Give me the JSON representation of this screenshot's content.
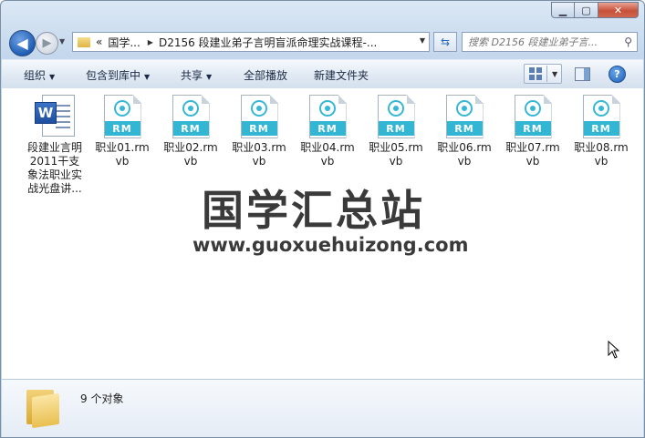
{
  "window": {
    "caption_buttons": {
      "minimize": "▁",
      "maximize": "▢",
      "close": "✕"
    }
  },
  "nav": {
    "back_icon": "arrow-left-icon",
    "forward_icon": "arrow-right-icon"
  },
  "address": {
    "overflow": "«",
    "crumb_1": "国学...",
    "separator": "▶",
    "crumb_2": "D2156 段建业弟子言明盲派命理实战课程-..."
  },
  "search": {
    "placeholder": "搜索 D2156 段建业弟子言..."
  },
  "toolbar": {
    "organize": "组织",
    "include_in_library": "包含到库中",
    "share": "共享",
    "play_all": "全部播放",
    "new_folder": "新建文件夹"
  },
  "files": [
    {
      "name": "段建业言明2011干支象法职业实战光盘讲...",
      "type": "word"
    },
    {
      "name": "职业01.rmvb",
      "type": "rmvb",
      "badge": "RM"
    },
    {
      "name": "职业02.rmvb",
      "type": "rmvb",
      "badge": "RM"
    },
    {
      "name": "职业03.rmvb",
      "type": "rmvb",
      "badge": "RM"
    },
    {
      "name": "职业04.rmvb",
      "type": "rmvb",
      "badge": "RM"
    },
    {
      "name": "职业05.rmvb",
      "type": "rmvb",
      "badge": "RM"
    },
    {
      "name": "职业06.rmvb",
      "type": "rmvb",
      "badge": "RM"
    },
    {
      "name": "职业07.rmvb",
      "type": "rmvb",
      "badge": "RM"
    },
    {
      "name": "职业08.rmvb",
      "type": "rmvb",
      "badge": "RM"
    }
  ],
  "word_icon_letter": "W",
  "watermark": {
    "title": "国学汇总站",
    "url": "www.guoxuehuizong.com"
  },
  "details": {
    "count": "9 个对象"
  },
  "colors": {
    "accent": "#33b5d4",
    "window_frame": "#c4d7ec"
  }
}
